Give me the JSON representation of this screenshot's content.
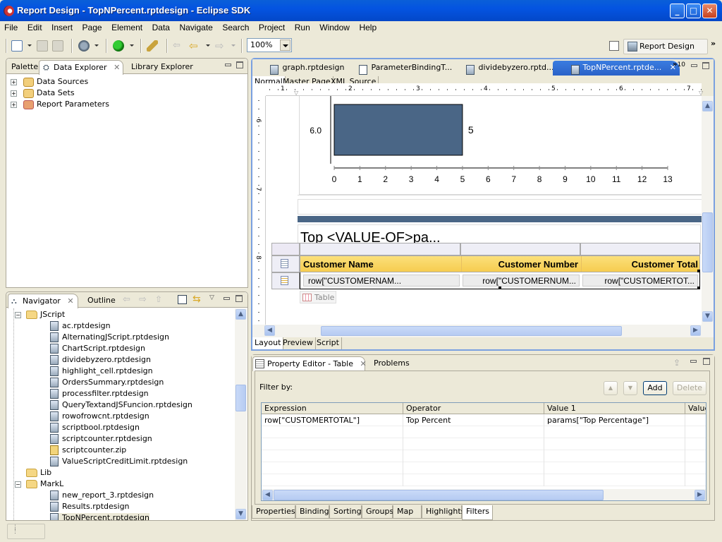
{
  "window": {
    "title": "Report Design - TopNPercent.rptdesign - Eclipse SDK",
    "minimize": "_",
    "maximize": "□",
    "close": "✕"
  },
  "menubar": [
    "File",
    "Edit",
    "Insert",
    "Page",
    "Element",
    "Data",
    "Navigate",
    "Search",
    "Project",
    "Run",
    "Window",
    "Help"
  ],
  "toolbar": {
    "zoom_value": "100%",
    "perspective_label": "Report Design",
    "overflow": "»"
  },
  "left_top_panel": {
    "tabs": [
      "Palette",
      "Data Explorer",
      "Library Explorer"
    ],
    "active_tab": "Data Explorer",
    "tree": [
      {
        "label": "Data Sources"
      },
      {
        "label": "Data Sets"
      },
      {
        "label": "Report Parameters"
      }
    ]
  },
  "navigator": {
    "tabs": [
      "Navigator",
      "Outline"
    ],
    "active_tab": "Navigator",
    "tree": [
      {
        "label": "JScript",
        "type": "folder",
        "level": 0,
        "expanded": true
      },
      {
        "label": "ac.rptdesign",
        "type": "report",
        "level": 1
      },
      {
        "label": "AlternatingJScript.rptdesign",
        "type": "report",
        "level": 1
      },
      {
        "label": "ChartScript.rptdesign",
        "type": "report",
        "level": 1
      },
      {
        "label": "dividebyzero.rptdesign",
        "type": "report",
        "level": 1
      },
      {
        "label": "highlight_cell.rptdesign",
        "type": "report",
        "level": 1
      },
      {
        "label": "OrdersSummary.rptdesign",
        "type": "report",
        "level": 1
      },
      {
        "label": "processfilter.rptdesign",
        "type": "report",
        "level": 1
      },
      {
        "label": "QueryTextandJSFuncion.rptdesign",
        "type": "report",
        "level": 1
      },
      {
        "label": "rowofrowcnt.rptdesign",
        "type": "report",
        "level": 1
      },
      {
        "label": "scriptbool.rptdesign",
        "type": "report",
        "level": 1
      },
      {
        "label": "scriptcounter.rptdesign",
        "type": "report",
        "level": 1
      },
      {
        "label": "scriptcounter.zip",
        "type": "zip",
        "level": 1
      },
      {
        "label": "ValueScriptCreditLimit.rptdesign",
        "type": "report",
        "level": 1
      },
      {
        "label": "Lib",
        "type": "folder",
        "level": 0,
        "expanded": false
      },
      {
        "label": "MarkL",
        "type": "folder",
        "level": 0,
        "expanded": true
      },
      {
        "label": "new_report_3.rptdesign",
        "type": "report",
        "level": 1
      },
      {
        "label": "Results.rptdesign",
        "type": "report",
        "level": 1
      },
      {
        "label": "TopNPercent.rptdesign",
        "type": "report",
        "level": 1,
        "selected": true
      }
    ]
  },
  "editor": {
    "tabs": [
      "graph.rptdesign",
      "ParameterBindingT...",
      "dividebyzero.rptd...",
      "TopNPercent.rptde..."
    ],
    "active_tab": "TopNPercent.rptde...",
    "hidden_tabs_count": "10",
    "view_tabs": [
      "Normal",
      "Master Page",
      "XML Source"
    ],
    "active_view_tab": "Normal",
    "bottom_tabs": [
      "Layout",
      "Preview",
      "Script"
    ],
    "active_bottom_tab": "Layout",
    "ruler_numbers": [
      "1",
      "2",
      "3",
      "4",
      "5",
      "6",
      "7"
    ],
    "vruler_numbers": [
      "6",
      "7",
      "8"
    ],
    "text_item": "Top <VALUE-OF>pa...",
    "table": {
      "headers": [
        "Customer Name",
        "Customer Number",
        "Customer Total"
      ],
      "detail": [
        "row[\"CUSTOMERNAM...",
        "row[\"CUSTOMERNUM...",
        "row[\"CUSTOMERTOT..."
      ],
      "label": "Table"
    }
  },
  "chart_data": {
    "type": "bar",
    "orientation": "horizontal",
    "categories": [
      "6.0"
    ],
    "values": [
      5
    ],
    "data_labels": [
      "5"
    ],
    "x_ticks": [
      "0",
      "1",
      "2",
      "3",
      "4",
      "5",
      "6",
      "7",
      "8",
      "9",
      "10",
      "11",
      "12",
      "13"
    ],
    "xlim": [
      0,
      13
    ],
    "bar_color": "#4a6686",
    "title": "",
    "xlabel": "",
    "ylabel": ""
  },
  "property_editor": {
    "tabs": [
      "Property Editor - Table",
      "Problems"
    ],
    "active_tab": "Property Editor - Table",
    "filter_label": "Filter by:",
    "buttons": {
      "up": "▲",
      "down": "▼",
      "add": "Add",
      "delete": "Delete"
    },
    "columns": [
      "Expression",
      "Operator",
      "Value 1",
      "Value"
    ],
    "rows": [
      [
        "row[\"CUSTOMERTOTAL\"]",
        "Top Percent",
        "params[\"Top Percentage\"]",
        ""
      ]
    ],
    "bottom_tabs": [
      "Properties",
      "Binding",
      "Sorting",
      "Groups",
      "Map",
      "Highlights",
      "Filters"
    ],
    "active_bottom_tab": "Filters"
  }
}
